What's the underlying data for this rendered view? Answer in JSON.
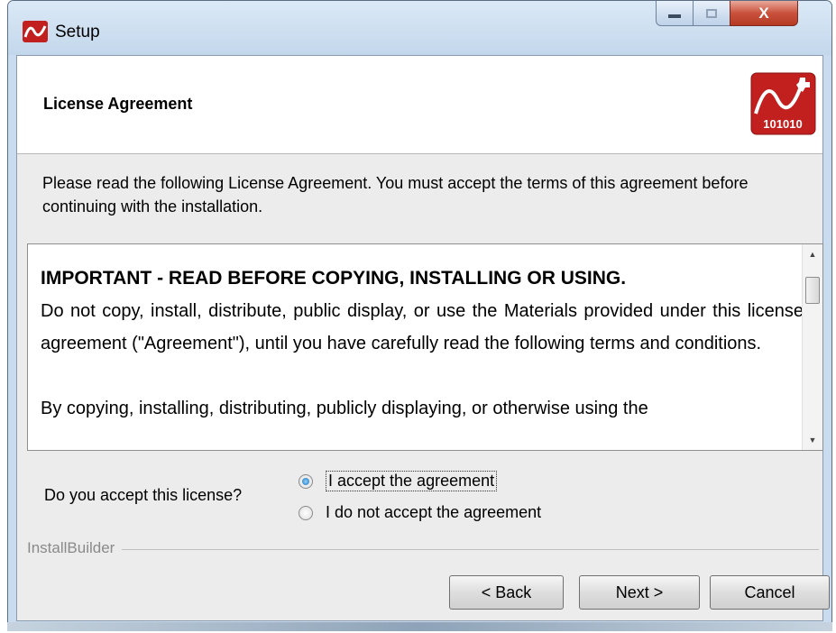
{
  "window": {
    "title": "Setup"
  },
  "caption": {
    "close_glyph": "X"
  },
  "header": {
    "title": "License Agreement",
    "logo_text": "101010"
  },
  "intro": "Please read the following License Agreement. You must accept the terms of this agreement before continuing with the installation.",
  "license": {
    "heading": "IMPORTANT - READ BEFORE COPYING, INSTALLING OR USING.",
    "para1": "Do not copy, install, distribute, public display, or use the Materials provided under this license agreement (\"Agreement\"), until you have carefully read the following terms and conditions.",
    "para2": "By copying, installing, distributing, publicly displaying, or otherwise using the"
  },
  "accept": {
    "question": "Do you accept this license?",
    "options": [
      {
        "label": "I accept the agreement",
        "selected": true
      },
      {
        "label": "I do not accept the agreement",
        "selected": false
      }
    ]
  },
  "footer": {
    "group_label": "InstallBuilder"
  },
  "buttons": {
    "back": "< Back",
    "next": "Next >",
    "cancel": "Cancel"
  },
  "colors": {
    "accent": "#1c6fb7",
    "logo_red": "#c21f1f",
    "close_red": "#c9523d"
  },
  "icons": {
    "app": "app-logo-icon",
    "scroll_up": "scroll-up-arrow-icon",
    "scroll_down": "scroll-down-arrow-icon"
  }
}
